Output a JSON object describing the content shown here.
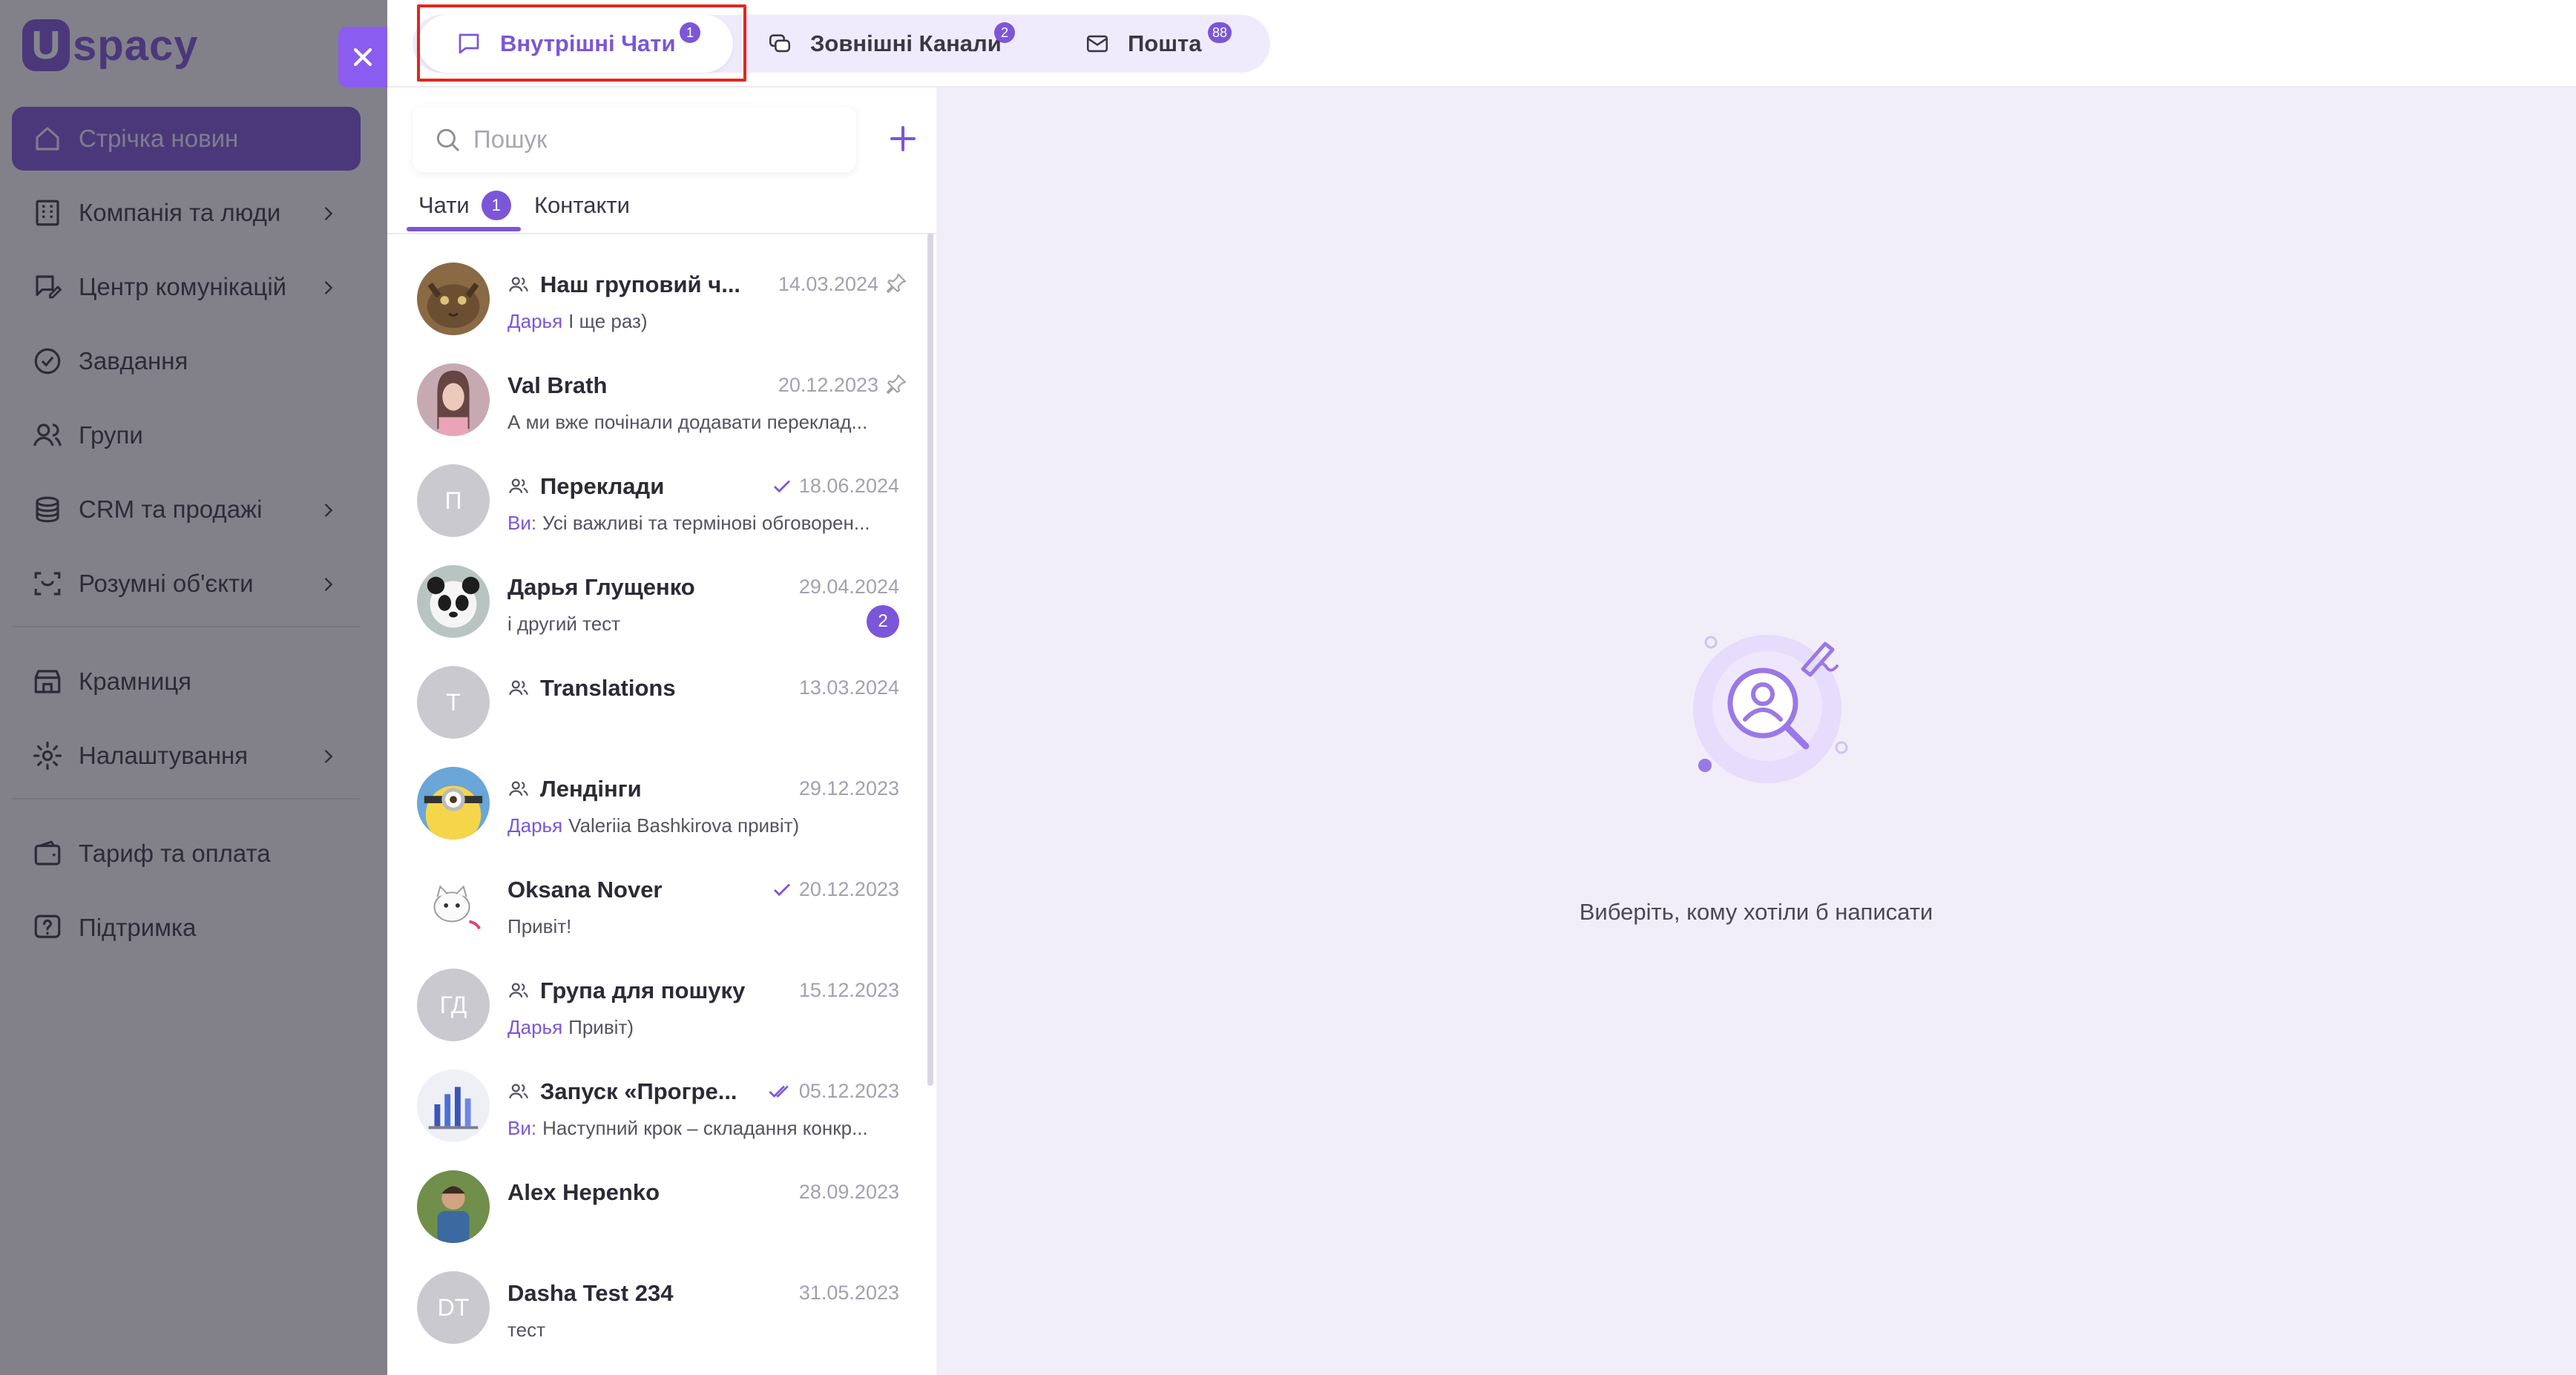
{
  "app": {
    "logo_letter": "U",
    "logo_text": "spacy"
  },
  "sidebar": {
    "items": [
      {
        "label": "Стрічка новин",
        "icon": "home-icon",
        "has_arrow": false,
        "active": true
      },
      {
        "label": "Компанія та люди",
        "icon": "building-icon",
        "has_arrow": true
      },
      {
        "label": "Центр комунікацій",
        "icon": "chat-edit-icon",
        "has_arrow": true
      },
      {
        "label": "Завдання",
        "icon": "check-circle-icon",
        "has_arrow": false
      },
      {
        "label": "Групи",
        "icon": "users-icon",
        "has_arrow": false
      },
      {
        "label": "CRM та продажі",
        "icon": "coins-icon",
        "has_arrow": true
      },
      {
        "label": "Розумні об'єкти",
        "icon": "scan-icon",
        "has_arrow": true
      },
      {
        "label": "Крамниця",
        "icon": "store-icon",
        "has_arrow": false
      },
      {
        "label": "Налаштування",
        "icon": "gear-icon",
        "has_arrow": true
      },
      {
        "label": "Тариф та оплата",
        "icon": "wallet-icon",
        "has_arrow": false
      },
      {
        "label": "Підтримка",
        "icon": "help-icon",
        "has_arrow": false
      }
    ]
  },
  "top_tabs": [
    {
      "label": "Внутрішні Чати",
      "badge": "1",
      "icon": "chat-bubble-icon",
      "active": true
    },
    {
      "label": "Зовнішні Канали",
      "badge": "2",
      "icon": "channels-icon",
      "active": false
    },
    {
      "label": "Пошта",
      "badge": "88",
      "icon": "mail-icon",
      "active": false
    }
  ],
  "search": {
    "placeholder": "Пошук"
  },
  "subtabs": [
    {
      "label": "Чати",
      "badge": "1",
      "active": true
    },
    {
      "label": "Контакти"
    }
  ],
  "chats": [
    {
      "name": "Наш груповий ч...",
      "group": true,
      "date": "14.03.2024",
      "pinned": true,
      "author": "Дарья",
      "text": "І ще раз)",
      "avatar": "photo-cat"
    },
    {
      "name": "Val Brath",
      "group": false,
      "date": "20.12.2023",
      "pinned": true,
      "author": "",
      "text": "А ми вже почінали додавати переклад...",
      "avatar": "photo-woman"
    },
    {
      "name": "Переклади",
      "group": true,
      "date": "18.06.2024",
      "check": "single",
      "author": "Ви:",
      "text": "Усі важливі та термінові обговорен...",
      "initials": "П"
    },
    {
      "name": "Дарья Глущенко",
      "group": false,
      "date": "29.04.2024",
      "author": "",
      "text": "і другий тест",
      "unread": "2",
      "avatar": "photo-panda"
    },
    {
      "name": "Translations",
      "group": true,
      "date": "13.03.2024",
      "author": "",
      "text": "",
      "initials": "T"
    },
    {
      "name": "Лендінги",
      "group": true,
      "date": "29.12.2023",
      "author": "Дарья",
      "text": "Valeriia Bashkirova привіт)",
      "avatar": "photo-minion"
    },
    {
      "name": "Oksana Nover",
      "group": false,
      "date": "20.12.2023",
      "check": "single",
      "author": "",
      "text": "Привіт!",
      "avatar": "photo-cartoon-cat"
    },
    {
      "name": "Група для пошуку",
      "group": true,
      "date": "15.12.2023",
      "author": "Дарья",
      "text": "Привіт)",
      "initials": "ГД"
    },
    {
      "name": "Запуск «Прогре...",
      "group": true,
      "date": "05.12.2023",
      "check": "double",
      "author": "Ви:",
      "text": "Наступний крок – складання конкр...",
      "avatar": "photo-chart"
    },
    {
      "name": "Alex Hepenko",
      "group": false,
      "date": "28.09.2023",
      "author": "",
      "text": "",
      "avatar": "photo-man"
    },
    {
      "name": "Dasha Test 234",
      "group": false,
      "date": "31.05.2023",
      "author": "",
      "text": "тест",
      "initials": "DT"
    }
  ],
  "empty_state": {
    "message": "Виберіть, кому хотіли б написати"
  },
  "colors": {
    "accent": "#7b56d8",
    "highlight": "#e0281c"
  }
}
